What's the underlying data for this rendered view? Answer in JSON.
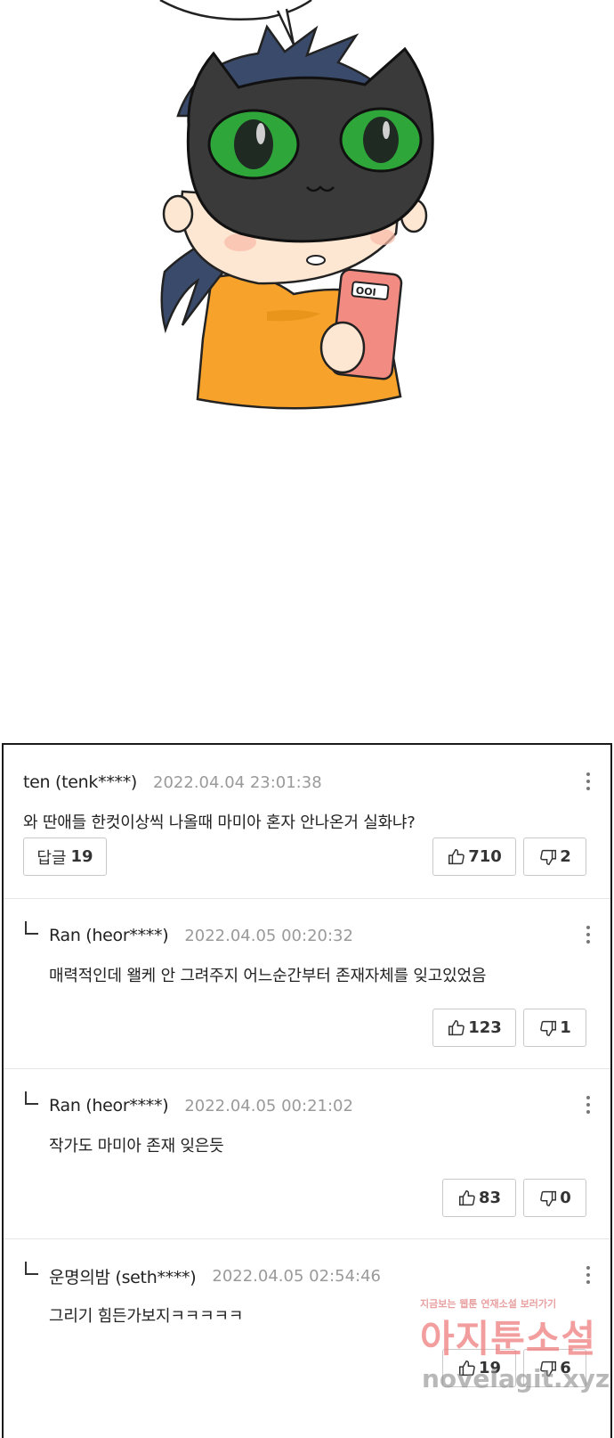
{
  "comic": {
    "phone_screen_text": "OOI"
  },
  "comments": [
    {
      "author": "ten (tenk****)",
      "date": "2022.04.04 23:01:38",
      "text": "와 딴애들 한컷이상씩 나올때 마미아 혼자 안나온거 실화냐?",
      "reply_label": "답글",
      "reply_count": "19",
      "likes": "710",
      "dislikes": "2",
      "is_reply": false
    },
    {
      "author": "Ran (heor****)",
      "date": "2022.04.05 00:20:32",
      "text": "매력적인데 왤케 안 그려주지 어느순간부터 존재자체를 잊고있었음",
      "likes": "123",
      "dislikes": "1",
      "is_reply": true
    },
    {
      "author": "Ran (heor****)",
      "date": "2022.04.05 00:21:02",
      "text": "작가도 마미아 존재 잊은듯",
      "likes": "83",
      "dislikes": "0",
      "is_reply": true
    },
    {
      "author": "운명의밤 (seth****)",
      "date": "2022.04.05 02:54:46",
      "text": "그리기 힘든가보지ㅋㅋㅋㅋㅋ",
      "likes": "19",
      "dislikes": "6",
      "is_reply": true
    }
  ],
  "watermark": {
    "tagline": "지금보는 웹툰 연재소설 보러가기",
    "site_name": "아지툰소설",
    "url": "novelagit.xyz"
  },
  "icons": {
    "like": "thumbs-up-icon",
    "dislike": "thumbs-down-icon",
    "more": "more-vertical-icon",
    "reply_marker": "reply-arrow-icon"
  },
  "colors": {
    "date_gray": "#9a9a9a",
    "button_border": "#c9c9c9",
    "shirt_orange": "#f7a22a",
    "eye_green": "#2fa63a",
    "phone_pink": "#f28b82",
    "mask_dark": "#3a3a3a",
    "watermark_red": "#f07e7e"
  }
}
